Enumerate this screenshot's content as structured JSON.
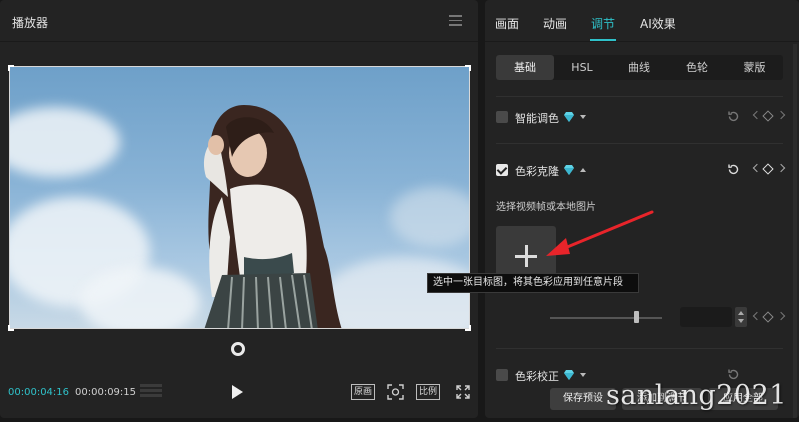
{
  "player": {
    "title": "播放器",
    "time_current": "00:00:04:16",
    "time_total": "00:00:09:15",
    "btn_original": "原画",
    "btn_ratio": "比例"
  },
  "panel": {
    "tabs": [
      {
        "label": "画面"
      },
      {
        "label": "动画"
      },
      {
        "label": "调节"
      },
      {
        "label": "AI效果"
      }
    ],
    "active_tab": "调节",
    "subtabs": [
      {
        "label": "基础"
      },
      {
        "label": "HSL"
      },
      {
        "label": "曲线"
      },
      {
        "label": "色轮"
      },
      {
        "label": "蒙版"
      }
    ],
    "active_subtab": "基础",
    "sections": {
      "smart_color": {
        "label": "智能调色",
        "checked": false
      },
      "color_clone": {
        "label": "色彩克隆",
        "checked": true,
        "hint": "选择视频帧或本地图片"
      },
      "color_correct": {
        "label": "色彩校正",
        "checked": false
      }
    },
    "bottom": {
      "save_preset": "保存预设",
      "add_to_track": "添加到调节",
      "apply_all": "应用全部"
    }
  },
  "tooltip": "选中一张目标图，将其色彩应用到任意片段",
  "watermark": "sanlang2021",
  "colors": {
    "accent": "#2fc1c9",
    "gem": "#5fd3e6",
    "arrow": "#e8242a"
  }
}
